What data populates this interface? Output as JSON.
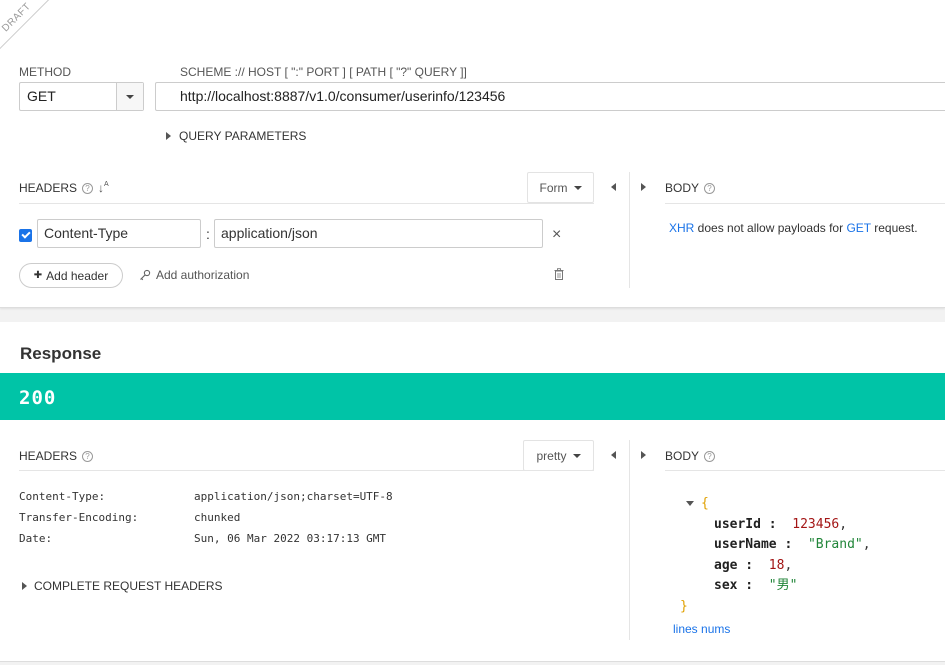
{
  "draft_label": "DRAFT",
  "request": {
    "method_label": "METHOD",
    "method_value": "GET",
    "url_label": "SCHEME :// HOST [ \":\" PORT ] [ PATH [ \"?\" QUERY ]]",
    "url_value": "http://localhost:8887/v1.0/consumer/userinfo/123456",
    "query_params_label": "QUERY PARAMETERS",
    "headers_label": "HEADERS",
    "help_glyph": "?",
    "sort_glyph": "↓",
    "sort_glyph_2": "A",
    "form_label": "Form",
    "header_rows": [
      {
        "name": "Content-Type",
        "value": "application/json",
        "checked": true
      }
    ],
    "colon": ":",
    "remove_glyph": "×",
    "add_header_label": "Add header",
    "add_header_plus": "✚",
    "add_auth_label": "Add authorization",
    "body_label": "BODY",
    "body_note": {
      "link1": "XHR",
      "middle": " does not allow payloads for ",
      "link2": "GET",
      "end": " request."
    }
  },
  "response": {
    "title": "Response",
    "status_code": "200",
    "status_color": "#00c4a7",
    "headers_label": "HEADERS",
    "pretty_label": "pretty",
    "headers": [
      {
        "name": "Content-Type:",
        "value": "application/json;charset=UTF-8"
      },
      {
        "name": "Transfer-Encoding:",
        "value": "chunked"
      },
      {
        "name": "Date:",
        "value": "Sun, 06 Mar 2022 03:17:13 GMT"
      }
    ],
    "complete_headers_label": "COMPLETE REQUEST HEADERS",
    "body_label": "BODY",
    "json": {
      "open": "{",
      "close": "}",
      "fields": [
        {
          "key": "userId",
          "value": "123456",
          "type": "num",
          "comma": ","
        },
        {
          "key": "userName",
          "value": "\"Brand\"",
          "type": "str",
          "comma": ","
        },
        {
          "key": "age",
          "value": "18",
          "type": "num",
          "comma": ","
        },
        {
          "key": "sex",
          "value": "\"男\"",
          "type": "str",
          "comma": ""
        }
      ]
    },
    "lines_nums_label": "lines nums"
  }
}
